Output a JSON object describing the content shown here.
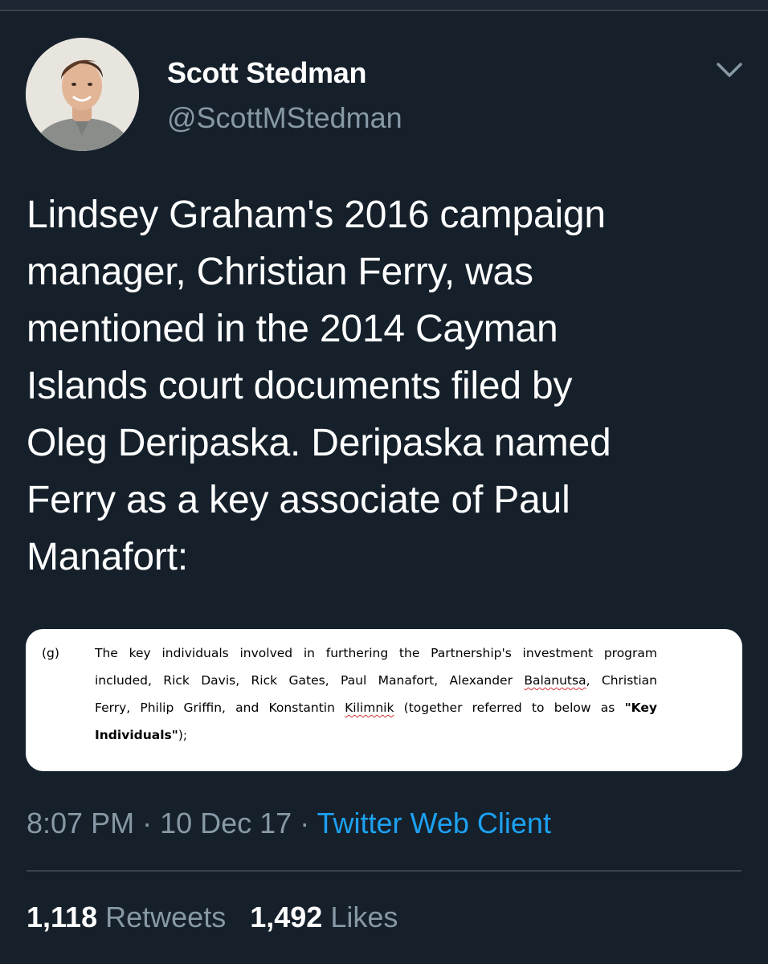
{
  "tweet": {
    "author": {
      "name": "Scott Stedman",
      "handle": "@ScottMStedman",
      "avatar_icon": "profile-photo"
    },
    "text_lines": [
      "Lindsey Graham's 2016 campaign",
      "manager, Christian Ferry, was",
      "mentioned in the 2014 Cayman",
      "Islands court documents filed by",
      "Oleg Deripaska. Deripaska named",
      "Ferry as a key associate of Paul",
      "Manafort:"
    ],
    "attached_image": {
      "label": "(g)",
      "line1": "The key individuals involved in furthering the Partnership's investment program",
      "line2_a": "included, Rick Davis, Rick Gates, Paul Manafort, Alexander ",
      "line2_b": "Balanutsa",
      "line2_c": ", Christian",
      "line3_a": "Ferry, Philip Griffin, and Konstantin ",
      "line3_b": "Kilimnik",
      "line3_c": " (together referred to below as ",
      "line3_d": "\"Key",
      "line4_a": "Individuals\"",
      "line4_b": ");"
    },
    "meta": {
      "time": "8:07 PM",
      "separator1": " · ",
      "date": "10 Dec 17",
      "separator2": " · ",
      "client": "Twitter Web Client"
    },
    "stats": {
      "retweets_count": "1,118",
      "retweets_label": "Retweets",
      "likes_count": "1,492",
      "likes_label": "Likes"
    }
  },
  "colors": {
    "background": "#15202b",
    "text": "#ffffff",
    "secondary": "#8899a6",
    "link": "#1da1f2",
    "divider": "#38444d"
  },
  "icons": {
    "menu": "chevron-down-icon"
  }
}
